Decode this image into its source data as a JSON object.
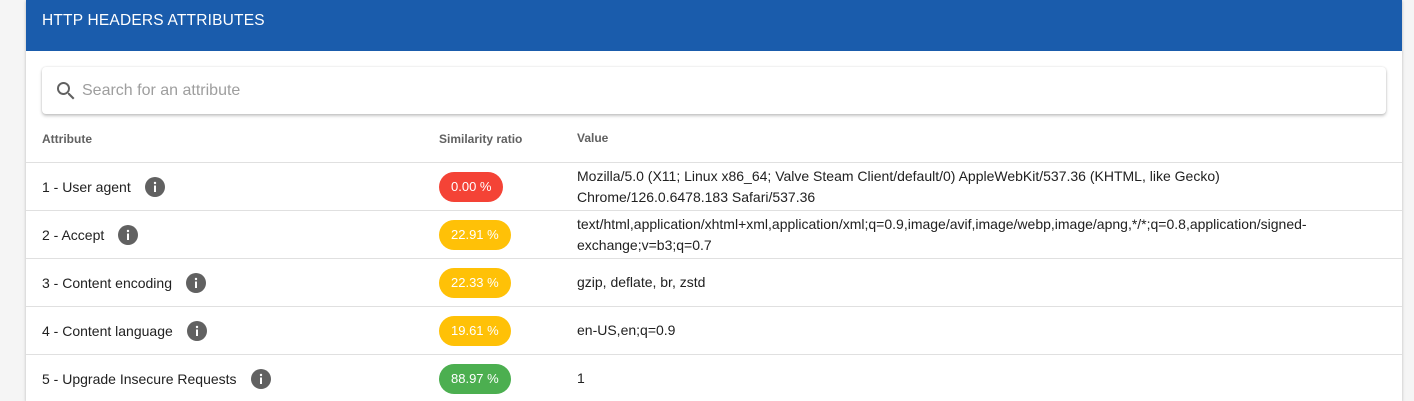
{
  "header": {
    "title": "HTTP HEADERS ATTRIBUTES"
  },
  "search": {
    "placeholder": "Search for an attribute",
    "icon": "search-icon"
  },
  "table": {
    "columns": [
      "Attribute",
      "Similarity ratio",
      "Value"
    ],
    "rows": [
      {
        "attribute": "1 - User agent",
        "ratio": "0.00 %",
        "ratio_color": "#f44336",
        "value": "Mozilla/5.0 (X11; Linux x86_64; Valve Steam Client/default/0) AppleWebKit/537.36 (KHTML, like Gecko) Chrome/126.0.6478.183 Safari/537.36"
      },
      {
        "attribute": "2 - Accept",
        "ratio": "22.91 %",
        "ratio_color": "#ffc107",
        "value": "text/html,application/xhtml+xml,application/xml;q=0.9,image/avif,image/webp,image/apng,*/*;q=0.8,application/signed-exchange;v=b3;q=0.7"
      },
      {
        "attribute": "3 - Content encoding",
        "ratio": "22.33 %",
        "ratio_color": "#ffc107",
        "value": "gzip, deflate, br, zstd"
      },
      {
        "attribute": "4 - Content language",
        "ratio": "19.61 %",
        "ratio_color": "#ffc107",
        "value": "en-US,en;q=0.9"
      },
      {
        "attribute": "5 - Upgrade Insecure Requests",
        "ratio": "88.97 %",
        "ratio_color": "#4caf50",
        "value": "1"
      }
    ]
  },
  "colors": {
    "header_bg": "#1a5cac",
    "red": "#f44336",
    "amber": "#ffc107",
    "green": "#4caf50"
  }
}
